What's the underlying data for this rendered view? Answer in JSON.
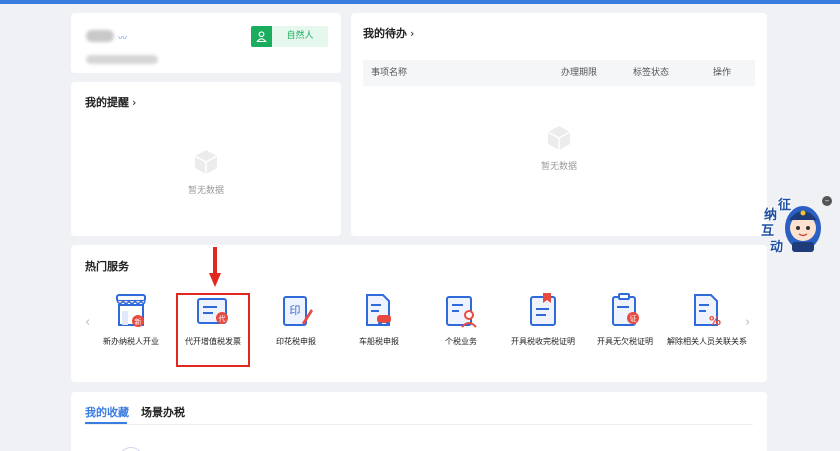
{
  "colors": {
    "brand": "#3a7de0",
    "green": "#1aad5e",
    "highlight": "#e0281e"
  },
  "profile": {
    "role_badge": "自然人"
  },
  "remind": {
    "title": "我的提醒",
    "arrow": "›",
    "empty_text": "暂无数据"
  },
  "todo": {
    "title": "我的待办",
    "arrow": "›",
    "columns": [
      "事项名称",
      "办理期限",
      "标签状态",
      "操作"
    ],
    "empty_text": "暂无数据"
  },
  "hot_services": {
    "title": "热门服务",
    "prev": "‹",
    "next": "›",
    "items": [
      {
        "label": "新办纳税人开业",
        "icon": "shop-new-icon"
      },
      {
        "label": "代开增值税发票",
        "icon": "invoice-proxy-icon"
      },
      {
        "label": "印花税申报",
        "icon": "stamp-tax-icon"
      },
      {
        "label": "车船税申报",
        "icon": "vehicle-tax-icon"
      },
      {
        "label": "个税业务",
        "icon": "personal-tax-icon"
      },
      {
        "label": "开具税收完税证明",
        "icon": "tax-paid-certificate-icon"
      },
      {
        "label": "开具无欠税证明",
        "icon": "no-arrears-certificate-icon"
      },
      {
        "label": "解除相关人员关联关系",
        "icon": "unlink-relation-icon"
      }
    ],
    "icon_glyphs": {
      "new": "新",
      "proxy": "代",
      "stamp": "印",
      "cert": "证"
    }
  },
  "favorites": {
    "tabs": [
      "我的收藏",
      "场景办税"
    ]
  },
  "assistant": {
    "chars": [
      "征",
      "纳",
      "互",
      "动"
    ]
  }
}
